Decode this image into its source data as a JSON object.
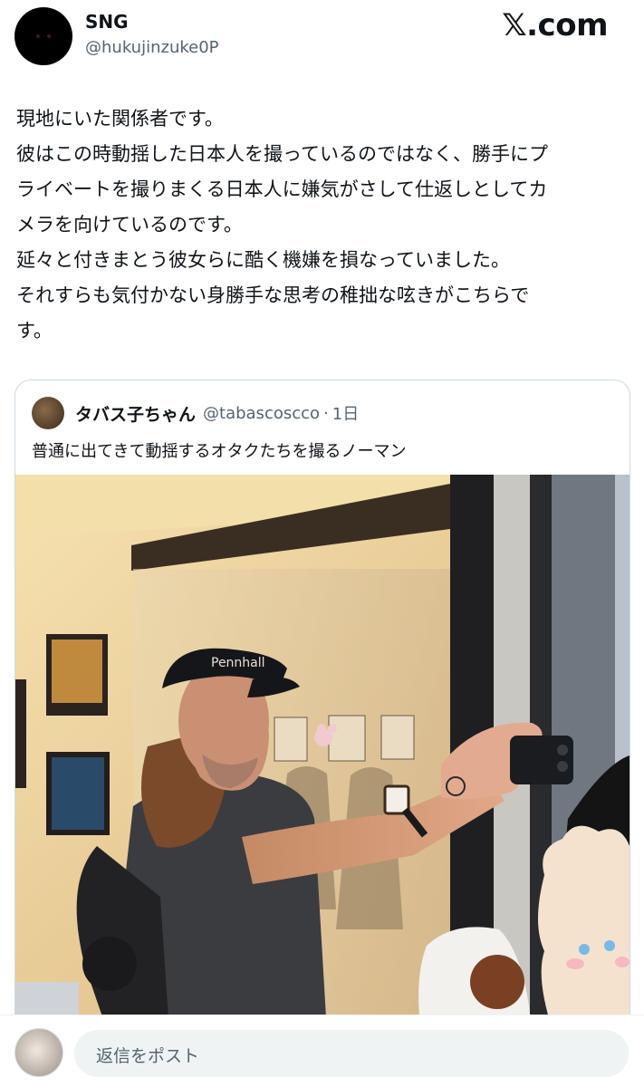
{
  "author": {
    "display_name": "SNG",
    "handle": "@hukujinzuke0P"
  },
  "brand": "𝕏.com",
  "post": {
    "lines": [
      "現地にいた関係者です。",
      "彼はこの時動揺した日本人を撮っているのではなく、勝手にプ",
      "ライベートを撮りまくる日本人に嫌気がさして仕返しとしてカ",
      "メラを向けているのです。",
      "延々と付きまとう彼女らに酷く機嫌を損なっていました。",
      "それすらも気付かない身勝手な思考の稚拙な呟きがこちらで",
      "す。"
    ]
  },
  "quoted": {
    "name": "タバス子ちゃん",
    "handle": "@tabascoscco",
    "separator": "·",
    "time": "1日",
    "text": "普通に出てきて動揺するオタクたちを撮るノーマン",
    "cap_text": "Pennhall"
  },
  "reply": {
    "placeholder": "返信をポスト"
  }
}
